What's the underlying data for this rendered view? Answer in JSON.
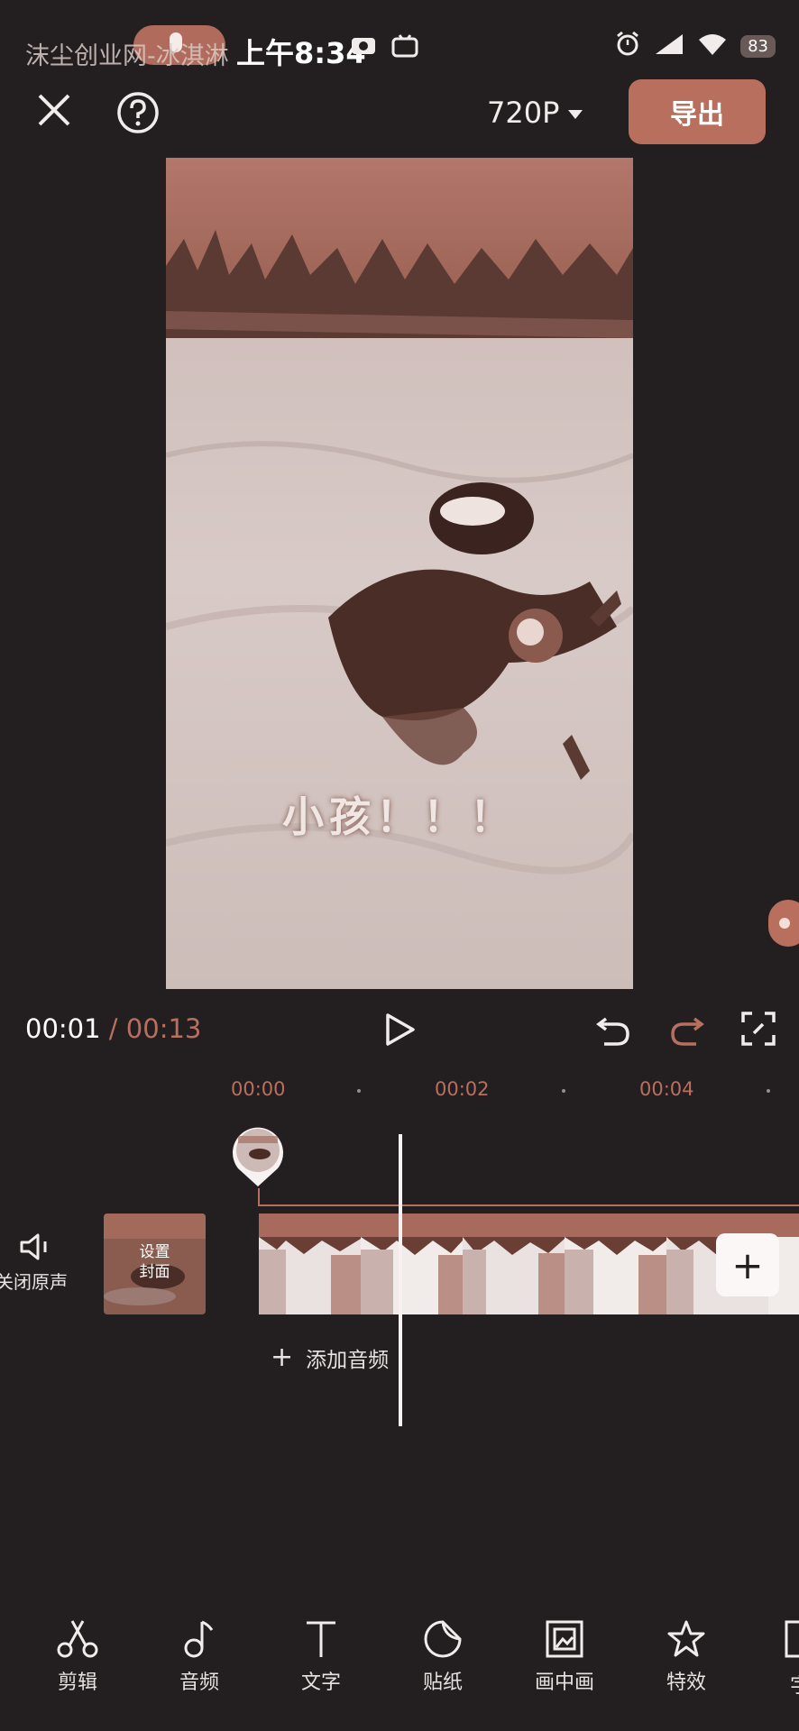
{
  "status_bar": {
    "left_text": "沫尘创业网-冰淇淋",
    "time": "上午8:34",
    "battery": "83",
    "icons": [
      "mic-icon",
      "bilibili-icon",
      "camera-icon",
      "alarm-icon",
      "signal-icon",
      "wifi-icon",
      "battery-icon"
    ]
  },
  "top_bar": {
    "resolution": "720P",
    "export_label": "导出",
    "icons": [
      "close-icon",
      "help-icon",
      "chevron-down-icon"
    ]
  },
  "preview": {
    "caption": "小孩！！！"
  },
  "playback": {
    "current_time": "00:01",
    "separator": "/",
    "total_time": "00:13",
    "icons": [
      "play-icon",
      "undo-icon",
      "redo-icon",
      "fullscreen-icon"
    ]
  },
  "ruler": {
    "ticks": [
      "00:00",
      "00:02",
      "00:04"
    ]
  },
  "timeline": {
    "mute_label": "关闭原声",
    "cover_label_1": "设置",
    "cover_label_2": "封面",
    "add_clip": "+",
    "add_audio_plus": "+",
    "add_audio_label": "添加音频"
  },
  "toolbar": {
    "items": [
      {
        "label": "剪辑",
        "icon": "scissors-icon"
      },
      {
        "label": "音频",
        "icon": "music-note-icon"
      },
      {
        "label": "文字",
        "icon": "text-icon"
      },
      {
        "label": "贴纸",
        "icon": "sticker-icon"
      },
      {
        "label": "画中画",
        "icon": "picture-in-picture-icon"
      },
      {
        "label": "特效",
        "icon": "star-effect-icon"
      },
      {
        "label": "字",
        "icon": "subtitle-icon"
      }
    ]
  },
  "colors": {
    "background": "#231f20",
    "accent": "#b96f5e",
    "text": "#e8e3e2"
  }
}
